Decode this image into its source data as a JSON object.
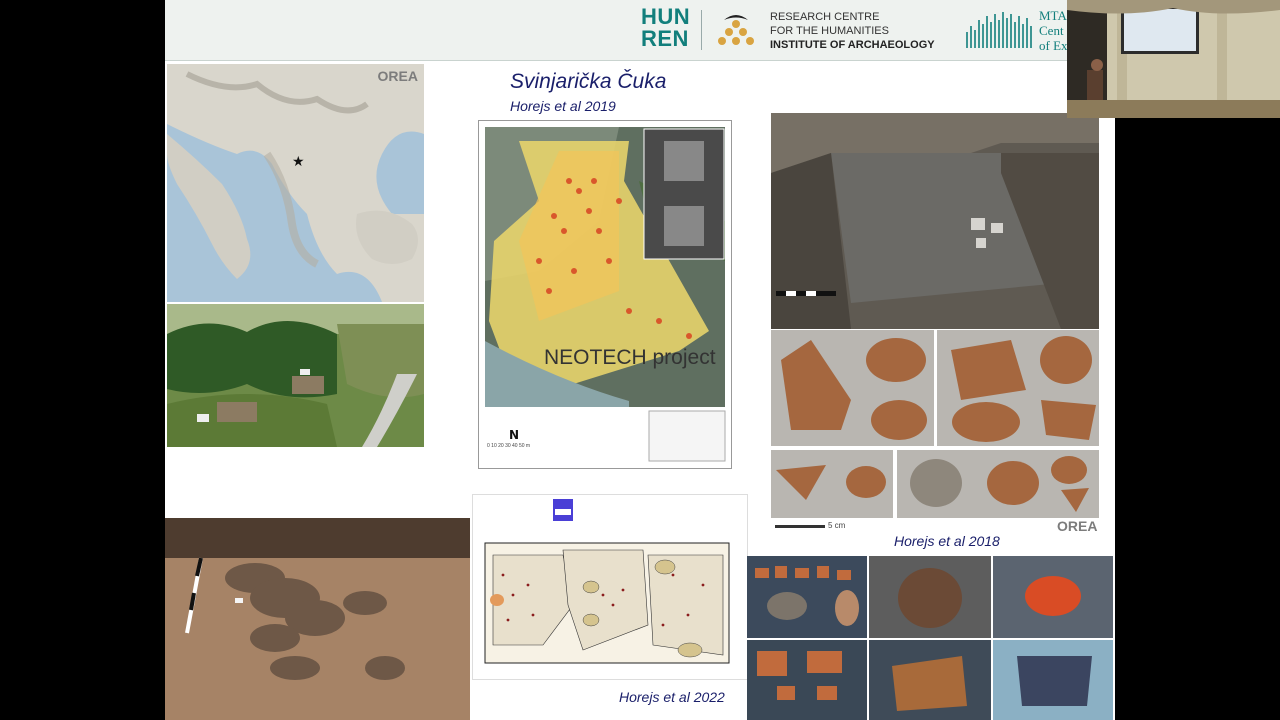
{
  "header": {
    "org_line1": "HUN",
    "org_line2": "REN",
    "rc_line1": "RESEARCH CENTRE",
    "rc_line2": "FOR THE HUMANITIES",
    "rc_line3": "INSTITUTE OF ARCHAEOLOGY",
    "mta_line1": "MTA",
    "mta_line2": "Cent",
    "mta_line3": "of Ex"
  },
  "slide": {
    "title": "Svinjarička Čuka",
    "subtitle": "Horejs et al 2019",
    "ref_2018": "Horejs et al 2018",
    "ref_2022": "Horejs et al 2022",
    "neotech": "NEOTECH project",
    "watermark_orea": "OREA",
    "scale_5cm": "5 cm",
    "north": "N",
    "map_scale": "0  10  20  30  40  50 m"
  },
  "colors": {
    "header_teal": "#127f7c",
    "title_navy": "#1a1f6a",
    "background": "#000000"
  }
}
